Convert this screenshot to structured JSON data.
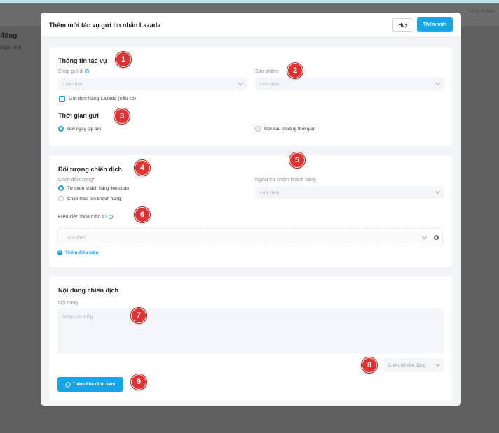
{
  "background": {
    "page_title": "động",
    "page_sub": "ất quy trình",
    "right_text": "hỗ trợ ôn kiện"
  },
  "modal": {
    "title": "Thêm mới tác vụ gửi tin nhắn Lazada",
    "cancel_label": "Huỷ",
    "add_label": "Thêm mới"
  },
  "task_info": {
    "title": "Thông tin tác vụ",
    "shop_label": "Shop gửi đi",
    "shop_placeholder": "Lựa chọn",
    "product_label": "Sản phẩm",
    "product_placeholder": "Lựa chọn",
    "checkbox_label": "Gửi đơn hàng Lazada (nếu có)",
    "send_time_title": "Thời gian gửi",
    "send_now": "Gửi ngay lập tức",
    "send_later": "Gửi sau khoảng thời gian"
  },
  "campaign_target": {
    "title": "Đối tượng chiến dịch",
    "choose_label": "Chọn đối tượng",
    "required_mark": "*",
    "option_related": "Tự chọn khách hàng liên quan",
    "option_by_name": "Chọn theo tên khách hàng",
    "exclude_label": "Ngoại trừ nhóm khách hàng",
    "exclude_placeholder": "Lựa chọn",
    "condition_label": "Điều kiện thỏa mãn",
    "condition_count": "#1",
    "condition_placeholder": "Lựa chọn",
    "add_condition": "Thêm điều kiện"
  },
  "campaign_content": {
    "title": "Nội dung chiến dịch",
    "content_label": "Nội dung",
    "content_placeholder": "Nhập nội dung",
    "dynamic_data": "Chèn dữ liệu động",
    "attach_file": "Thêm File đính kèm"
  },
  "markers": [
    "1",
    "2",
    "3",
    "4",
    "5",
    "6",
    "7",
    "8",
    "9"
  ],
  "colors": {
    "accent": "#18a4e8",
    "marker": "#e53030",
    "overlay": "#5f5f5f"
  }
}
